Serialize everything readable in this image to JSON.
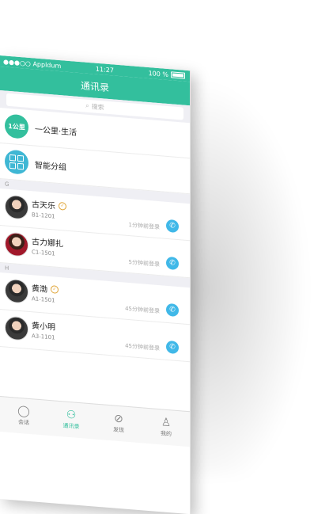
{
  "colors": {
    "brand": "#33bf9d",
    "call": "#40b8e8",
    "verified": "#e0a63a"
  },
  "status": {
    "carrier": "●●●○○ Appldum",
    "time": "11:27",
    "battery": "100 %"
  },
  "nav": {
    "title": "通讯录"
  },
  "search": {
    "placeholder": "搜索"
  },
  "special": [
    {
      "label": "一公里·生活",
      "badge": "1公里"
    },
    {
      "label": "智能分组"
    }
  ],
  "sections": [
    {
      "letter": "G",
      "contacts": [
        {
          "name": "古天乐",
          "room": "B1-1201",
          "login": "1分钟前登录",
          "verified": true
        },
        {
          "name": "古力娜扎",
          "room": "C1-1501",
          "login": "5分钟前登录",
          "verified": false
        }
      ]
    },
    {
      "letter": "H",
      "contacts": [
        {
          "name": "黄渤",
          "room": "A1-1501",
          "login": "45分钟前登录",
          "verified": true
        },
        {
          "name": "黄小明",
          "room": "A3-1101",
          "login": "45分钟前登录",
          "verified": false
        }
      ]
    }
  ],
  "tabs": [
    {
      "label": "会话",
      "icon": "chat-bubble-icon"
    },
    {
      "label": "通讯录",
      "icon": "contacts-icon",
      "active": true
    },
    {
      "label": "发现",
      "icon": "compass-icon"
    },
    {
      "label": "我的",
      "icon": "person-icon"
    }
  ]
}
